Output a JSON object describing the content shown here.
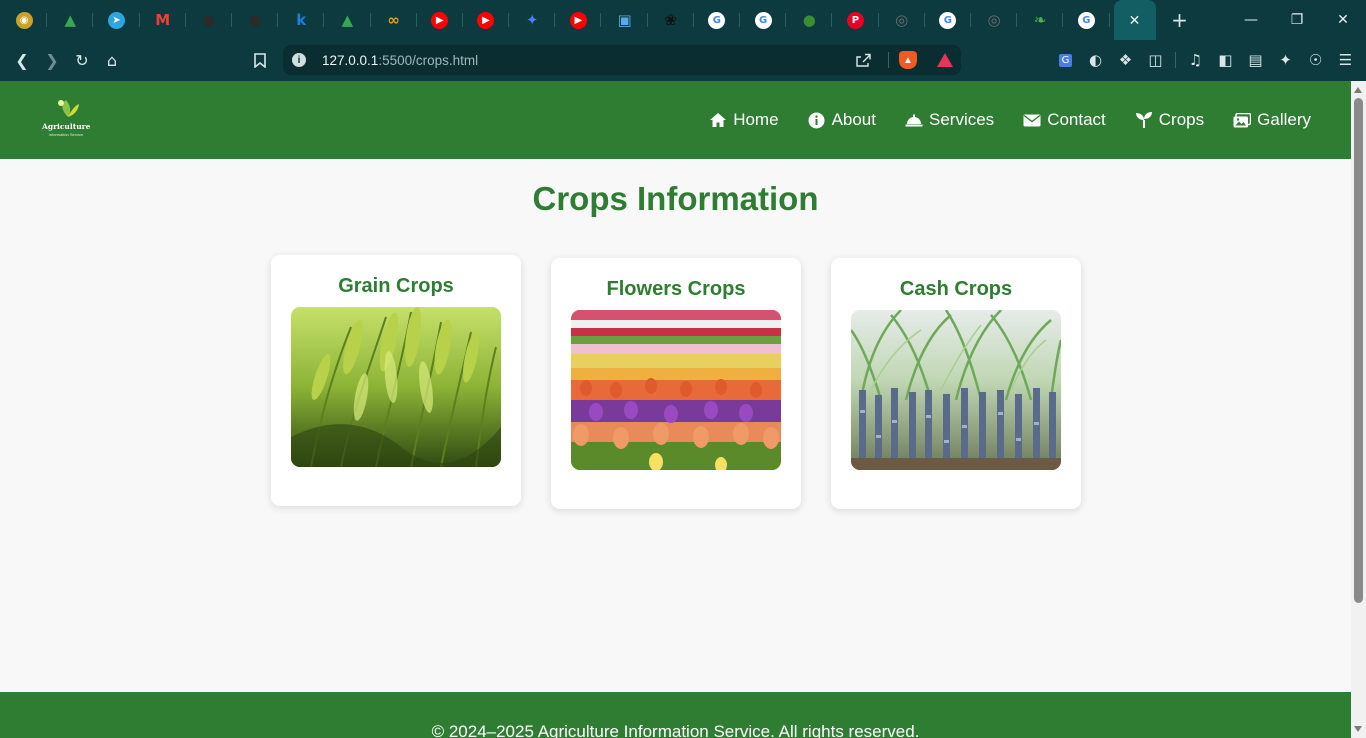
{
  "browser": {
    "tabs": [
      {
        "icon": "round-badge-icon",
        "color": "#c9a227"
      },
      {
        "icon": "drive-icon",
        "color": "#34a853"
      },
      {
        "icon": "telegram-icon",
        "color": "#2ca5e0"
      },
      {
        "icon": "gmail-icon",
        "color": "#ea4335"
      },
      {
        "icon": "github-icon",
        "color": "#2b2b2b"
      },
      {
        "icon": "github-icon",
        "color": "#2b2b2b"
      },
      {
        "icon": "k-letter-icon",
        "color": "#1d7fd6"
      },
      {
        "icon": "drive-icon",
        "color": "#34a853"
      },
      {
        "icon": "infinity-icon",
        "color": "#e8a317"
      },
      {
        "icon": "youtube-icon",
        "color": "#ff0000"
      },
      {
        "icon": "youtube-icon",
        "color": "#ff0000"
      },
      {
        "icon": "gemini-icon",
        "color": "#4f7df5"
      },
      {
        "icon": "youtube-icon",
        "color": "#ff0000"
      },
      {
        "icon": "picture-in-picture-icon",
        "color": "#5aa9e6"
      },
      {
        "icon": "openai-icon",
        "color": "#111111"
      },
      {
        "icon": "google-icon",
        "color": "#4285f4"
      },
      {
        "icon": "google-icon",
        "color": "#4285f4"
      },
      {
        "icon": "green-circle-icon",
        "color": "#3c8d2f"
      },
      {
        "icon": "pinterest-icon",
        "color": "#e60023"
      },
      {
        "icon": "globe-icon",
        "color": "#6e6e6e"
      },
      {
        "icon": "google-icon",
        "color": "#4285f4"
      },
      {
        "icon": "globe-icon",
        "color": "#6e6e6e"
      },
      {
        "icon": "leaf-icon",
        "color": "#4caf50"
      },
      {
        "icon": "google-icon",
        "color": "#4285f4"
      }
    ],
    "url_host": "127.0.0.1",
    "url_rest": ":5500/crops.html"
  },
  "site": {
    "logo_text": "Agriculture",
    "logo_sub": "Information Service",
    "nav": [
      {
        "label": "Home",
        "icon": "home-icon"
      },
      {
        "label": "About",
        "icon": "info-icon"
      },
      {
        "label": "Services",
        "icon": "service-bell-icon"
      },
      {
        "label": "Contact",
        "icon": "envelope-icon"
      },
      {
        "label": "Crops",
        "icon": "seedling-icon"
      },
      {
        "label": "Gallery",
        "icon": "images-icon"
      }
    ],
    "title": "Crops Information",
    "cards": [
      {
        "title": "Grain Crops",
        "image": "wheat field"
      },
      {
        "title": "Flowers Crops",
        "image": "tulip field"
      },
      {
        "title": "Cash Crops",
        "image": "sugarcane field"
      }
    ],
    "footer": "© 2024–2025 Agriculture Information Service. All rights reserved."
  },
  "colors": {
    "brand_green": "#2e7d32",
    "chrome_bg": "#0c3a3f",
    "page_bg": "#f8f8f8"
  }
}
